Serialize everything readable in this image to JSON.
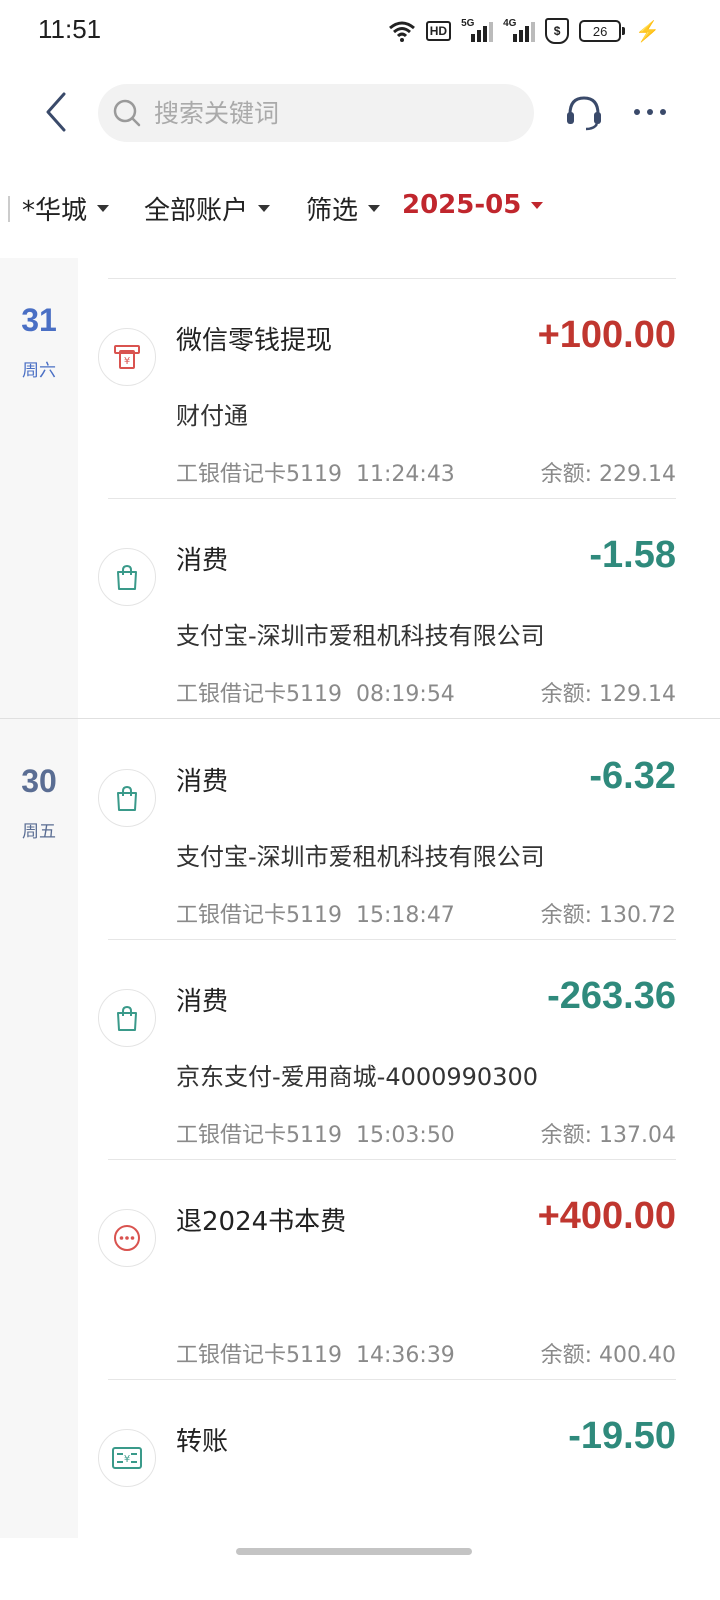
{
  "status_bar": {
    "time": "11:51",
    "hd_label": "HD",
    "signal1_label": "5G",
    "signal2_label": "4G",
    "battery_level": "26"
  },
  "header": {
    "search_placeholder": "搜索关键词",
    "icons": {
      "back": "back-chevron-icon",
      "search": "search-icon",
      "support": "headset-icon",
      "more": "more-dots-icon"
    }
  },
  "filters": {
    "account_name": "*华城",
    "all_accounts": "全部账户",
    "filter_label": "筛选",
    "month": "2025-05"
  },
  "colors": {
    "income": "#c0362f",
    "expense": "#2f8a7c",
    "date_filter": "#c0262d",
    "day_blue": "#4a6fc4",
    "day_gray": "#5a6d93"
  },
  "days": [
    {
      "day": "31",
      "weekday": "周六",
      "transactions": [
        {
          "icon": "atm-withdraw-icon",
          "title": "微信零钱提现",
          "merchant": "财付通",
          "amount": "+100.00",
          "account": "工银借记卡5119",
          "time": "11:24:43",
          "balance": "余额: 229.14"
        },
        {
          "icon": "shopping-bag-icon",
          "title": "消费",
          "merchant": "支付宝-深圳市爱租机科技有限公司",
          "amount": "-1.58",
          "account": "工银借记卡5119",
          "time": "08:19:54",
          "balance": "余额: 129.14"
        }
      ]
    },
    {
      "day": "30",
      "weekday": "周五",
      "transactions": [
        {
          "icon": "shopping-bag-icon",
          "title": "消费",
          "merchant": "支付宝-深圳市爱租机科技有限公司",
          "amount": "-6.32",
          "account": "工银借记卡5119",
          "time": "15:18:47",
          "balance": "余额: 130.72"
        },
        {
          "icon": "shopping-bag-icon",
          "title": "消费",
          "merchant": "京东支付-爱用商城-4000990300",
          "amount": "-263.36",
          "account": "工银借记卡5119",
          "time": "15:03:50",
          "balance": "余额: 137.04"
        },
        {
          "icon": "other-dots-icon",
          "title": "退2024书本费",
          "merchant": "",
          "amount": "+400.00",
          "account": "工银借记卡5119",
          "time": "14:36:39",
          "balance": "余额: 400.40"
        },
        {
          "icon": "transfer-icon",
          "title": "转账",
          "merchant": "",
          "amount": "-19.50",
          "account": "",
          "time": "",
          "balance": ""
        }
      ]
    }
  ]
}
